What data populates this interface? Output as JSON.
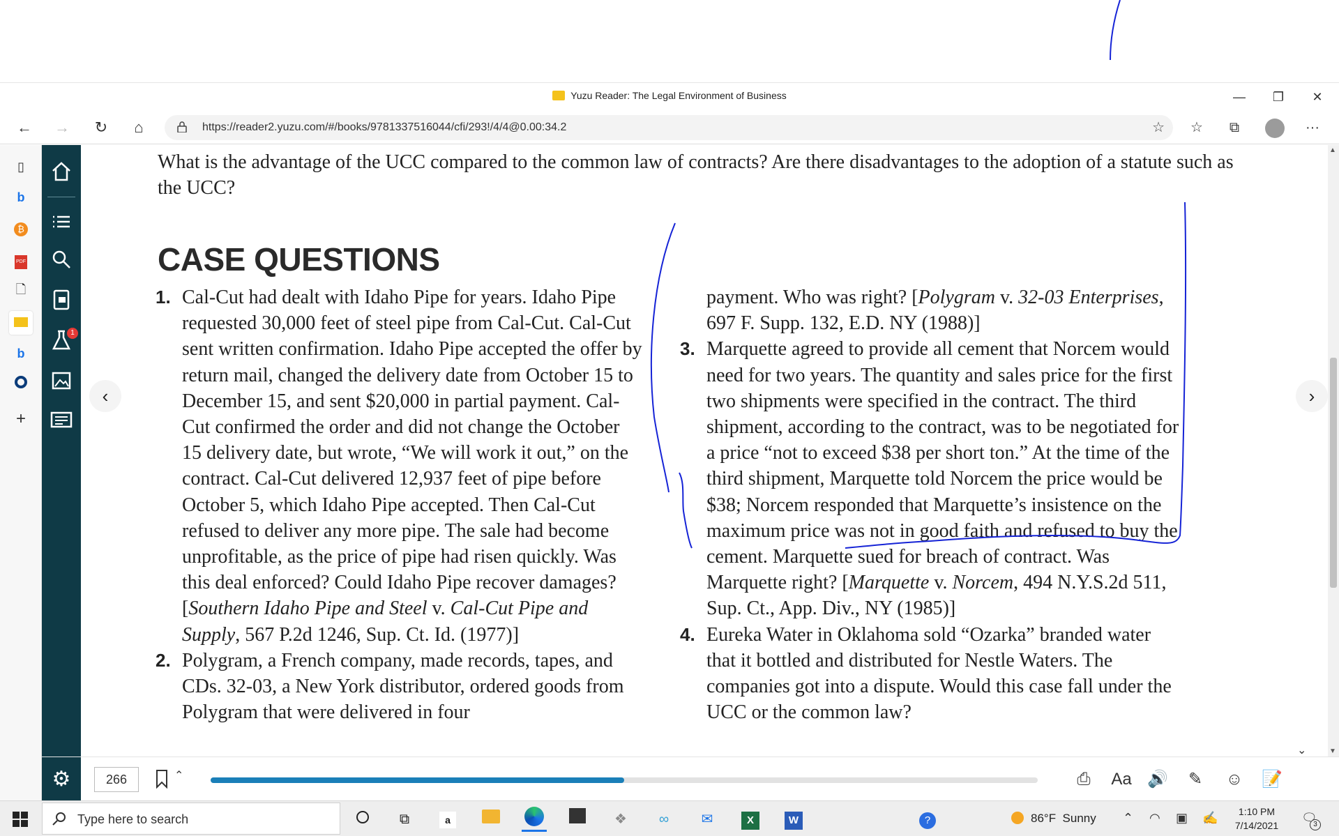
{
  "window": {
    "title": "Yuzu Reader: The Legal Environment of Business",
    "favicon_text": "Yuzu",
    "minimize": "—",
    "restore": "❐",
    "close": "✕"
  },
  "browser": {
    "url": "https://reader2.yuzu.com/#/books/9781337516044/cfi/293!/4/4@0.00:34.2",
    "back": "←",
    "forward": "→",
    "refresh": "↻",
    "home": "⌂",
    "more": "···"
  },
  "book": {
    "intro_question": "What is the advantage of the UCC compared to the common law of contracts? Are there disadvantages to the adoption of a statute such as the UCC?",
    "heading": "CASE QUESTIONS",
    "q1_num": "1.",
    "q1_text": "Cal-Cut had dealt with Idaho Pipe for years. Idaho Pipe requested 30,000 feet of steel pipe from Cal-Cut. Cal-Cut sent written confirmation. Idaho Pipe accepted the offer by return mail, changed the delivery date from October 15 to December 15, and sent $20,000 in partial payment. Cal-Cut confirmed the order and did not change the October 15 delivery date, but wrote, “We will work it out,” on the contract. Cal-Cut delivered 12,937 feet of pipe before October 5, which Idaho Pipe accepted. Then Cal-Cut refused to deliver any more pipe. The sale had become unprofitable, as the price of pipe had risen quickly. Was this deal enforced? Could Idaho Pipe recover damages? [",
    "q1_cite_a": "Southern Idaho Pipe and Steel",
    "q1_cite_v": " v. ",
    "q1_cite_b": "Cal-Cut Pipe and Supply",
    "q1_cite_end": ", 567 P.2d 1246, Sup. Ct. Id. (1977)]",
    "q2_num": "2.",
    "q2_text": "Polygram, a French company, made records, tapes, and CDs. 32-03, a New York distributor, ordered goods from Polygram that were delivered in four",
    "q2_cont_text": "payment. Who was right? [",
    "q2_cite_a": "Polygram",
    "q2_cite_v": " v. ",
    "q2_cite_b": "32-03 Enterprises",
    "q2_cite_end": ", 697 F. Supp. 132, E.D. NY (1988)]",
    "q3_num": "3.",
    "q3_text": "Marquette agreed to provide all cement that Norcem would need for two years. The quantity and sales price for the first two shipments were specified in the contract. The third shipment, according to the contract, was to be negotiated for a price “not to exceed $38 per short ton.” At the time of the third shipment, Marquette told Norcem the price would be $38; Norcem responded that Marquette’s insistence on the maximum price was not in good faith and refused to buy the cement. Marquette sued for breach of contract. Was Marquette right? [",
    "q3_cite_a": "Marquette",
    "q3_cite_v": " v. ",
    "q3_cite_b": "Norcem",
    "q3_cite_end": ", 494 N.Y.S.2d 511, Sup. Ct., App. Div., NY (1985)]",
    "q4_num": "4.",
    "q4_text": "Eureka Water in Oklahoma sold “Ozarka” branded water that it bottled and distributed for Nestle Waters. The companies got into a dispute. Would this case fall under the UCC or the common law?",
    "prev_arrow": "‹",
    "next_arrow": "›"
  },
  "reader_bar": {
    "page_number": "266",
    "progress_percent": 0.5,
    "font_button": "Aa"
  },
  "sidebar_badge": "1",
  "taskbar": {
    "search_placeholder": "Type here to search",
    "weather_temp": "86°F",
    "weather_text": "Sunny",
    "time": "1:10 PM",
    "date": "7/14/2021",
    "notification_count": "3"
  },
  "colors": {
    "reader_sidebar": "#0f3a46",
    "progress_fill": "#1a7fb8",
    "annotation_ink": "#1523d6"
  }
}
